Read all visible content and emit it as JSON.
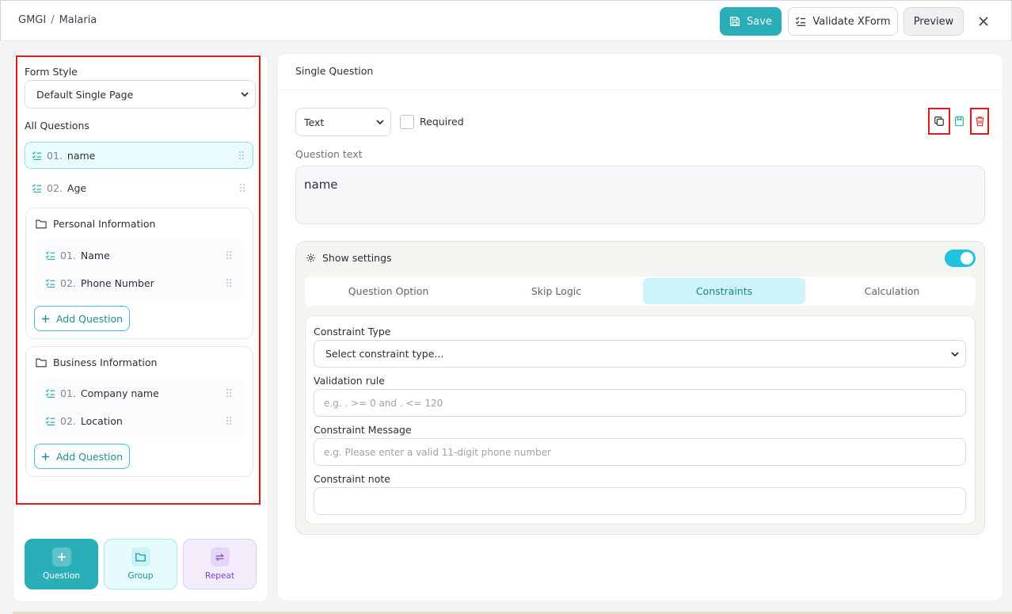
{
  "breadcrumb": {
    "org": "GMGI",
    "sep": "/",
    "project": "Malaria"
  },
  "toolbar": {
    "save_label": "Save",
    "validate_label": "Validate XForm",
    "preview_label": "Preview"
  },
  "sidebar": {
    "form_style_label": "Form Style",
    "form_style_value": "Default Single Page",
    "all_questions_label": "All Questions",
    "questions": [
      {
        "num": "01.",
        "label": "name"
      },
      {
        "num": "02.",
        "label": "Age"
      }
    ],
    "groups": [
      {
        "title": "Personal Information",
        "items": [
          {
            "num": "01.",
            "label": "Name"
          },
          {
            "num": "02.",
            "label": "Phone Number"
          }
        ],
        "add_label": "Add Question"
      },
      {
        "title": "Business Information",
        "items": [
          {
            "num": "01.",
            "label": "Company name"
          },
          {
            "num": "02.",
            "label": "Location"
          }
        ],
        "add_label": "Add Question"
      }
    ],
    "tiles": {
      "question": "Question",
      "group": "Group",
      "repeat": "Repeat"
    }
  },
  "editor": {
    "title": "Single Question",
    "type_value": "Text",
    "required_label": "Required",
    "question_text_label": "Question text",
    "question_text_value": "name",
    "show_settings_label": "Show settings",
    "tabs": [
      "Question Option",
      "Skip Logic",
      "Constraints",
      "Calculation"
    ],
    "active_tab": "Constraints",
    "constraint_type_label": "Constraint Type",
    "constraint_type_value": "Select constraint type...",
    "validation_rule_label": "Validation rule",
    "validation_rule_placeholder": "e.g. . >= 0 and . <= 120",
    "constraint_message_label": "Constraint Message",
    "constraint_message_placeholder": "e.g. Please enter a valid 11-digit phone number",
    "constraint_note_label": "Constraint note",
    "constraint_note_placeholder": ""
  },
  "colors": {
    "accent": "#2aaeb8",
    "highlight": "#e01b1b",
    "toggle": "#22c3de",
    "delete": "#e0312b"
  }
}
